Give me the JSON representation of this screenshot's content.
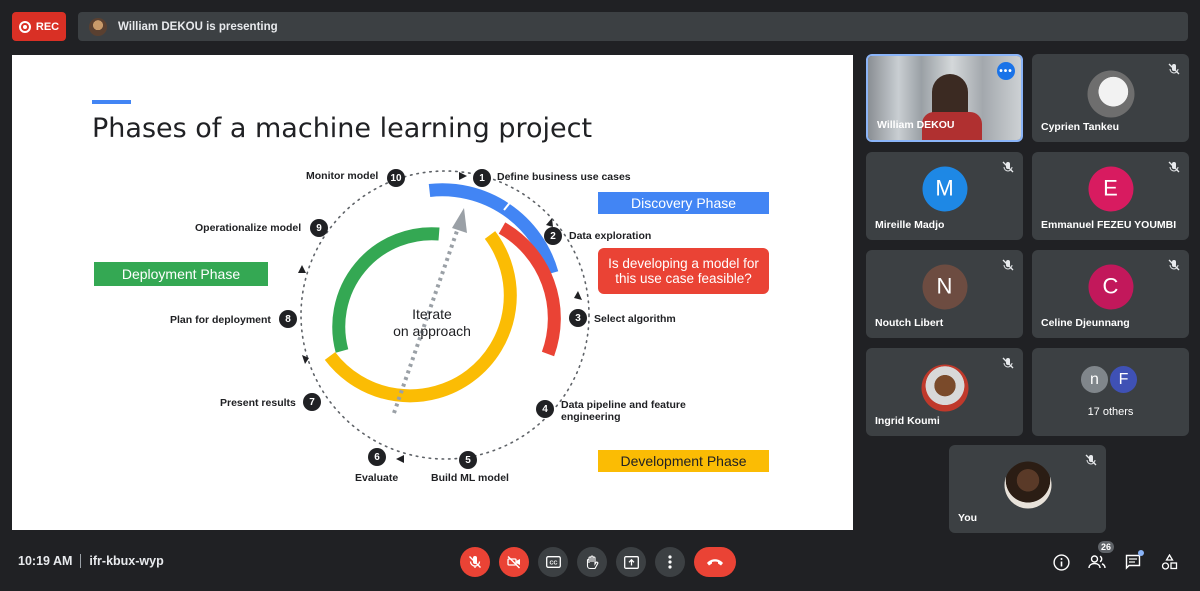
{
  "top_bar": {
    "rec_label": "REC",
    "presenting_text": "William DEKOU is presenting"
  },
  "slide": {
    "title": "Phases of a machine learning project",
    "center_text_line1": "Iterate",
    "center_text_line2": "on approach",
    "phases": {
      "discovery": "Discovery Phase",
      "deployment": "Deployment Phase",
      "development": "Development Phase",
      "feasible": "Is developing a model for this use case feasible?"
    },
    "steps": [
      {
        "num": "1",
        "label": "Define business use cases"
      },
      {
        "num": "2",
        "label": "Data exploration"
      },
      {
        "num": "3",
        "label": "Select algorithm"
      },
      {
        "num": "4",
        "label": "Data pipeline and feature engineering"
      },
      {
        "num": "5",
        "label": "Build ML model"
      },
      {
        "num": "6",
        "label": "Evaluate"
      },
      {
        "num": "7",
        "label": "Present results"
      },
      {
        "num": "8",
        "label": "Plan for deployment"
      },
      {
        "num": "9",
        "label": "Operationalize model"
      },
      {
        "num": "10",
        "label": "Monitor model"
      }
    ],
    "colors": {
      "blue": "#4285f4",
      "red": "#ea4335",
      "yellow": "#fbbc04",
      "green": "#34a853"
    }
  },
  "participants": [
    {
      "name": "William DEKOU",
      "type": "video",
      "active": true
    },
    {
      "name": "Cyprien Tankeu",
      "type": "photo",
      "muted": true
    },
    {
      "name": "Mireille Madjo",
      "initial": "M",
      "color": "#1e88e5",
      "muted": true
    },
    {
      "name": "Emmanuel FEZEU YOUMBI",
      "initial": "E",
      "color": "#d81b60",
      "muted": true
    },
    {
      "name": "Noutch Libert",
      "initial": "N",
      "color": "#6d4c41",
      "muted": true
    },
    {
      "name": "Celine Djeunnang",
      "initial": "C",
      "color": "#c2185b",
      "muted": true
    },
    {
      "name": "Ingrid Koumi",
      "type": "photo",
      "muted": true
    },
    {
      "name": "You",
      "type": "photo",
      "muted": true
    }
  ],
  "others": {
    "initial_1": "n",
    "initial_2": "F",
    "label": "17 others"
  },
  "bottom_bar": {
    "time": "10:19 AM",
    "meeting_code": "ifr-kbux-wyp",
    "people_count": "26"
  }
}
